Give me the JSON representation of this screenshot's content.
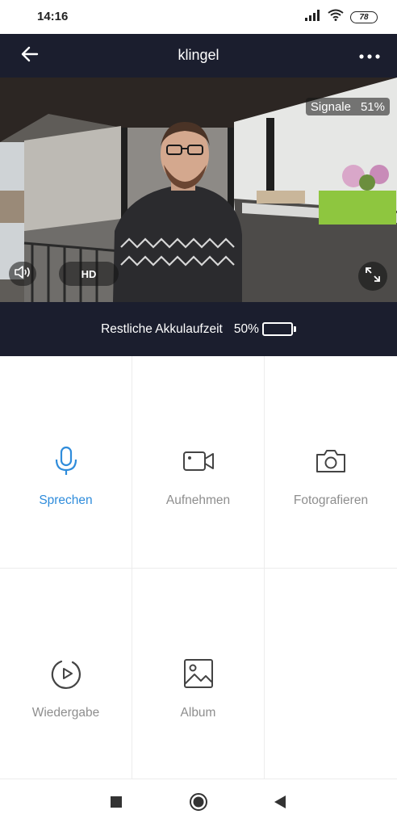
{
  "status_bar": {
    "time": "14:16",
    "battery": "78"
  },
  "header": {
    "title": "klingel",
    "back_icon": "arrow-left-icon",
    "more_icon": "more-horizontal-icon"
  },
  "video": {
    "signal_label": "Signale",
    "signal_value": "51%",
    "quality_label": "HD",
    "volume_icon": "speaker-icon",
    "fullscreen_icon": "expand-icon"
  },
  "battery_info": {
    "label": "Restliche Akkulaufzeit",
    "percent_text": "50%",
    "level": 0.5,
    "fill_color": "#f5a623"
  },
  "actions": [
    {
      "label": "Sprechen",
      "icon": "microphone-icon",
      "active": true
    },
    {
      "label": "Aufnehmen",
      "icon": "video-camera-icon",
      "active": false
    },
    {
      "label": "Fotografieren",
      "icon": "camera-icon",
      "active": false
    },
    {
      "label": "Wiedergabe",
      "icon": "playback-icon",
      "active": false
    },
    {
      "label": "Album",
      "icon": "image-icon",
      "active": false
    }
  ],
  "colors": {
    "header_bg": "#1b1e2e",
    "accent": "#2f8cdb",
    "inactive_text": "#8e8e8e"
  }
}
